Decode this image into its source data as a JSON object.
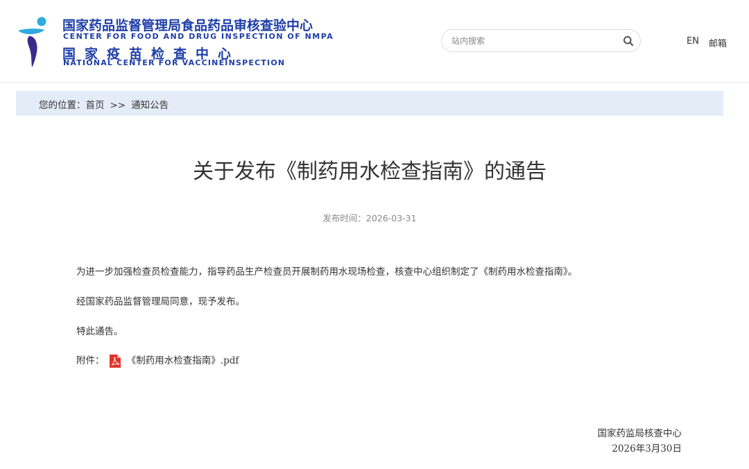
{
  "header": {
    "org_name_cn": "国家药品监督管理局食品药品审核查验中心",
    "org_name_en": "CENTER FOR FOOD AND DRUG INSPECTION OF NMPA",
    "vaccine_center_cn": "国家疫苗检查中心",
    "vaccine_center_en": "NATIONAL CENTER FOR VACCINEINSPECTION",
    "search_placeholder": "站内搜索",
    "lang_label": "EN",
    "mail_label": "邮箱"
  },
  "breadcrumb": {
    "prefix": "您的位置：",
    "home": "首页",
    "separator": ">>",
    "current": "通知公告"
  },
  "article": {
    "title": "关于发布《制药用水检查指南》的通告",
    "publish_time": "发布时间：2026-03-31",
    "paragraphs": [
      "为进一步加强检查员检查能力，指导药品生产检查员开展制药用水现场检查，核查中心组织制定了《制药用水检查指南》。",
      "经国家药品监督管理局同意，现予发布。",
      "特此通告。"
    ],
    "attachment_label": "附件：",
    "attachment_name": "《制药用水检查指南》.pdf",
    "signature_org": "国家药监局核查中心",
    "signature_date": "2026年3月30日"
  },
  "colors": {
    "brand_blue": "#1e3ea8",
    "logo_cyan": "#2fa9e0",
    "breadcrumb_bg": "#e4edf7",
    "pdf_red": "#e2322d"
  },
  "icons": {
    "logo": "nmpa-logo-icon",
    "search": "search-icon",
    "pdf": "pdf-file-icon"
  }
}
